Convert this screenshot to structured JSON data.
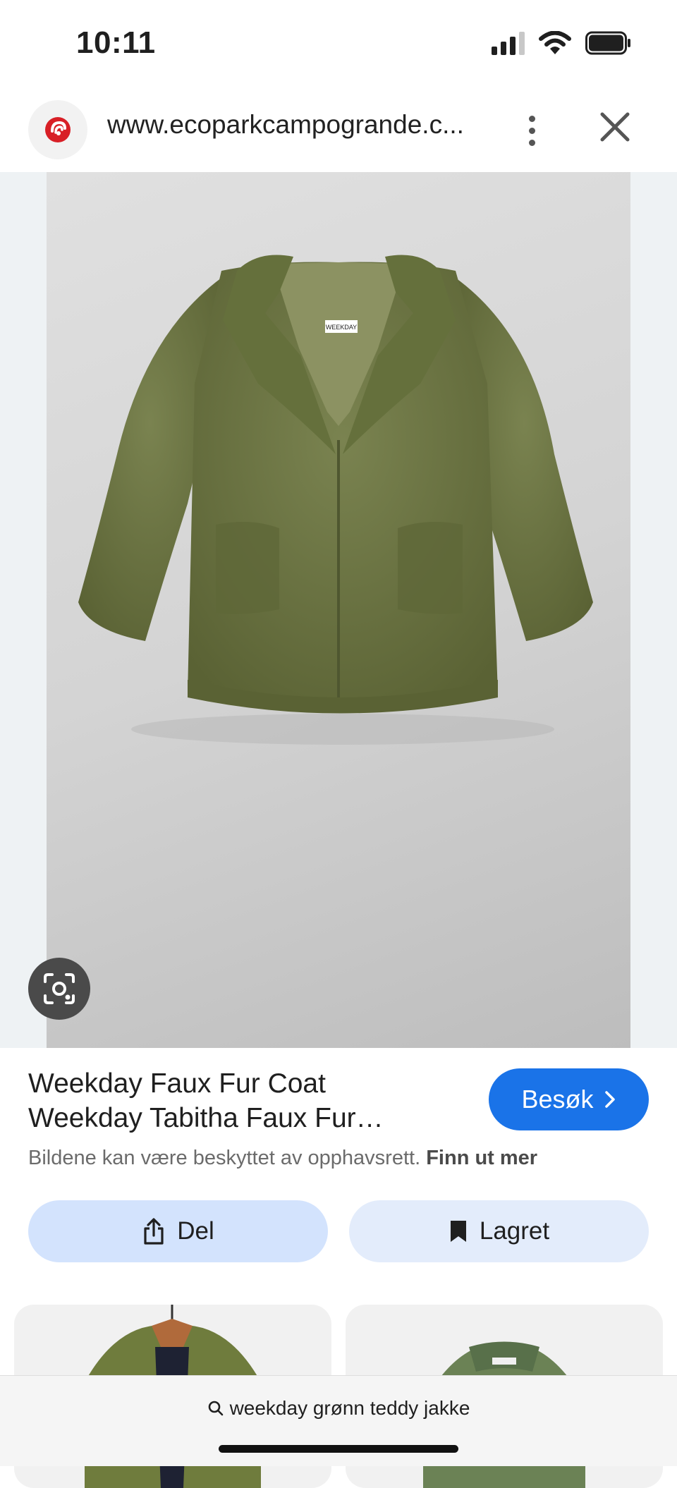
{
  "status_bar": {
    "time": "10:11"
  },
  "url_bar": {
    "url": "www.ecoparkcampogrande.c..."
  },
  "result": {
    "title_line1": "Weekday Faux Fur Coat",
    "title_line2": "Weekday Tabitha Faux Fur…",
    "visit_label": "Besøk",
    "copyright_text": "Bildene kan være beskyttet av opphavsrett.",
    "copyright_link": "Finn ut mer",
    "tag_label": "WEEKDAY"
  },
  "actions": {
    "share_label": "Del",
    "saved_label": "Lagret"
  },
  "bottom_bar": {
    "search_query": "weekday grønn teddy jakke"
  },
  "colors": {
    "accent": "#1a73e8",
    "coat": "#6b7440",
    "share_bg": "#d3e3fd",
    "saved_bg": "#e3ecfb"
  },
  "icons": [
    "signal-icon",
    "wifi-icon",
    "battery-icon",
    "site-favicon-icon",
    "more-vert-icon",
    "close-icon",
    "lens-icon",
    "chevron-right-icon",
    "share-icon",
    "bookmark-icon",
    "search-icon"
  ]
}
